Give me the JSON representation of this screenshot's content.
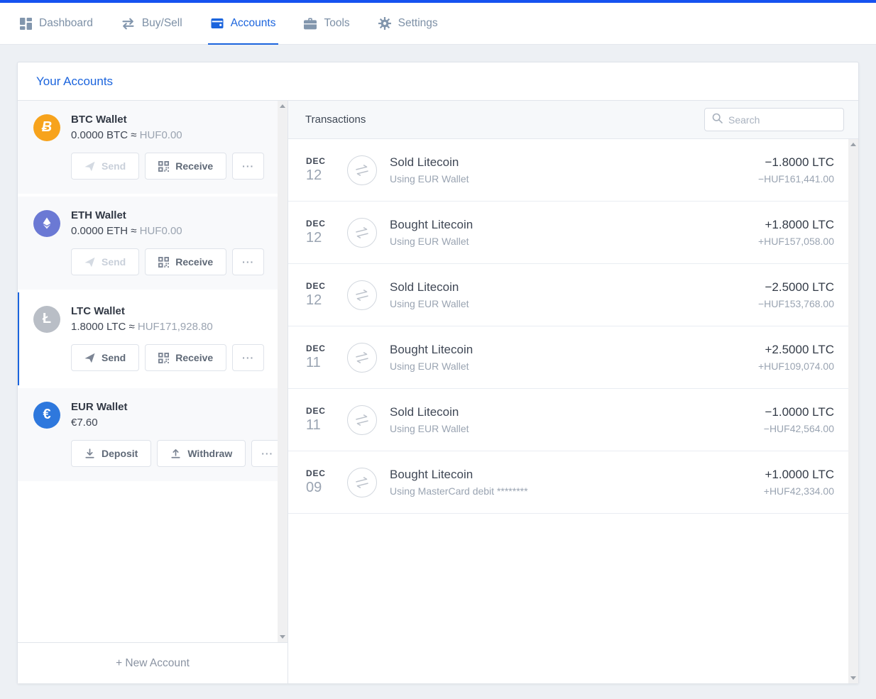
{
  "colors": {
    "top_border_blue": "#1652f0",
    "accent_blue": "#1b64dd",
    "btc_orange": "#f7a31c",
    "eth_indigo": "#6b79d4",
    "ltc_gray": "#b9bec6",
    "eur_blue": "#2e78dd"
  },
  "nav": {
    "items": [
      {
        "label": "Dashboard",
        "icon": "dashboard-grid-icon",
        "active": false
      },
      {
        "label": "Buy/Sell",
        "icon": "buy-sell-arrows-icon",
        "active": false
      },
      {
        "label": "Accounts",
        "icon": "wallet-icon",
        "active": true
      },
      {
        "label": "Tools",
        "icon": "briefcase-icon",
        "active": false
      },
      {
        "label": "Settings",
        "icon": "gear-icon",
        "active": false
      }
    ]
  },
  "accounts_panel": {
    "title": "Your Accounts",
    "approx_symbol": "≈",
    "more_label": "···",
    "new_account_label": "+ New Account",
    "wallets": [
      {
        "name": "BTC Wallet",
        "amount": "0.0000 BTC",
        "fiat": "HUF0.00",
        "circle_color": "#f7a31c",
        "symbol": "Ƀ",
        "logo": "btc-logo-icon",
        "selected": false,
        "buttons": [
          {
            "label": "Send",
            "icon": "send-icon",
            "disabled": true
          },
          {
            "label": "Receive",
            "icon": "qr-code-icon",
            "disabled": false
          }
        ]
      },
      {
        "name": "ETH Wallet",
        "amount": "0.0000 ETH",
        "fiat": "HUF0.00",
        "circle_color": "#6b79d4",
        "symbol": "",
        "logo": "eth-logo-icon",
        "selected": false,
        "buttons": [
          {
            "label": "Send",
            "icon": "send-icon",
            "disabled": true
          },
          {
            "label": "Receive",
            "icon": "qr-code-icon",
            "disabled": false
          }
        ]
      },
      {
        "name": "LTC Wallet",
        "amount": "1.8000 LTC",
        "fiat": "HUF171,928.80",
        "circle_color": "#b9bec6",
        "symbol": "Ł",
        "logo": "ltc-logo-icon",
        "selected": true,
        "buttons": [
          {
            "label": "Send",
            "icon": "send-icon",
            "disabled": false
          },
          {
            "label": "Receive",
            "icon": "qr-code-icon",
            "disabled": false
          }
        ]
      },
      {
        "name": "EUR Wallet",
        "amount": "€7.60",
        "fiat": "",
        "circle_color": "#2e78dd",
        "symbol": "€",
        "logo": "eur-logo-icon",
        "selected": false,
        "buttons": [
          {
            "label": "Deposit",
            "icon": "deposit-icon",
            "disabled": false
          },
          {
            "label": "Withdraw",
            "icon": "withdraw-icon",
            "disabled": false
          }
        ]
      }
    ]
  },
  "transactions": {
    "title": "Transactions",
    "search_placeholder": "Search",
    "rows": [
      {
        "month": "DEC",
        "day": "12",
        "title": "Sold Litecoin",
        "subtitle": "Using EUR Wallet",
        "amount": "−1.8000 LTC",
        "fiat": "−HUF161,441.00"
      },
      {
        "month": "DEC",
        "day": "12",
        "title": "Bought Litecoin",
        "subtitle": "Using EUR Wallet",
        "amount": "+1.8000 LTC",
        "fiat": "+HUF157,058.00"
      },
      {
        "month": "DEC",
        "day": "12",
        "title": "Sold Litecoin",
        "subtitle": "Using EUR Wallet",
        "amount": "−2.5000 LTC",
        "fiat": "−HUF153,768.00"
      },
      {
        "month": "DEC",
        "day": "11",
        "title": "Bought Litecoin",
        "subtitle": "Using EUR Wallet",
        "amount": "+2.5000 LTC",
        "fiat": "+HUF109,074.00"
      },
      {
        "month": "DEC",
        "day": "11",
        "title": "Sold Litecoin",
        "subtitle": "Using EUR Wallet",
        "amount": "−1.0000 LTC",
        "fiat": "−HUF42,564.00"
      },
      {
        "month": "DEC",
        "day": "09",
        "title": "Bought Litecoin",
        "subtitle": "Using MasterCard debit ********",
        "amount": "+1.0000 LTC",
        "fiat": "+HUF42,334.00"
      }
    ]
  }
}
